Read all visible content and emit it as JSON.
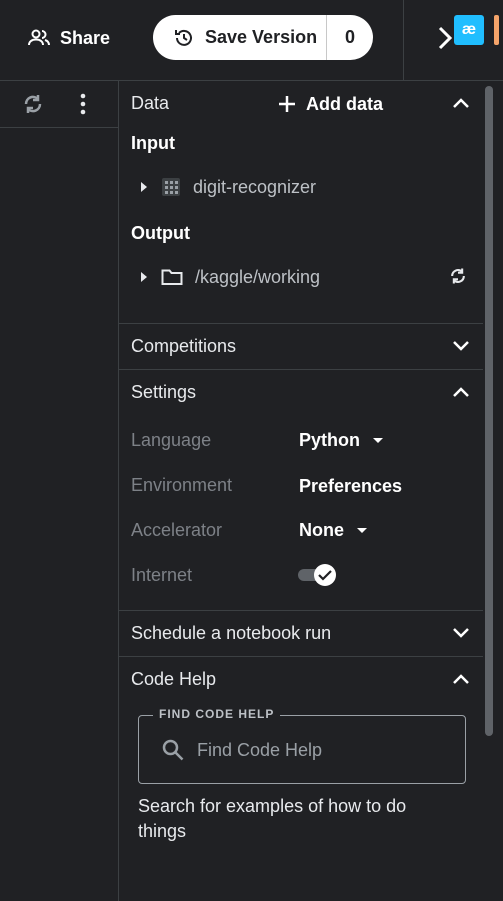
{
  "header": {
    "share_label": "Share",
    "save_version_label": "Save Version",
    "save_version_count": "0",
    "logo_text": "æ"
  },
  "data_section": {
    "title": "Data",
    "add_data_label": "Add data",
    "input_label": "Input",
    "input_items": [
      {
        "label": "digit-recognizer"
      }
    ],
    "output_label": "Output",
    "output_items": [
      {
        "label": "/kaggle/working"
      }
    ]
  },
  "competitions": {
    "title": "Competitions"
  },
  "settings": {
    "title": "Settings",
    "language_label": "Language",
    "language_value": "Python",
    "environment_label": "Environment",
    "environment_value": "Preferences",
    "accelerator_label": "Accelerator",
    "accelerator_value": "None",
    "internet_label": "Internet",
    "internet_on": true
  },
  "schedule": {
    "title": "Schedule a notebook run"
  },
  "code_help": {
    "title": "Code Help",
    "legend": "FIND CODE HELP",
    "placeholder": "Find Code Help",
    "description": "Search for examples of how to do things"
  },
  "colors": {
    "background": "#202124",
    "accent_logo": "#20beff",
    "orange_badge": "#f5a46a"
  }
}
